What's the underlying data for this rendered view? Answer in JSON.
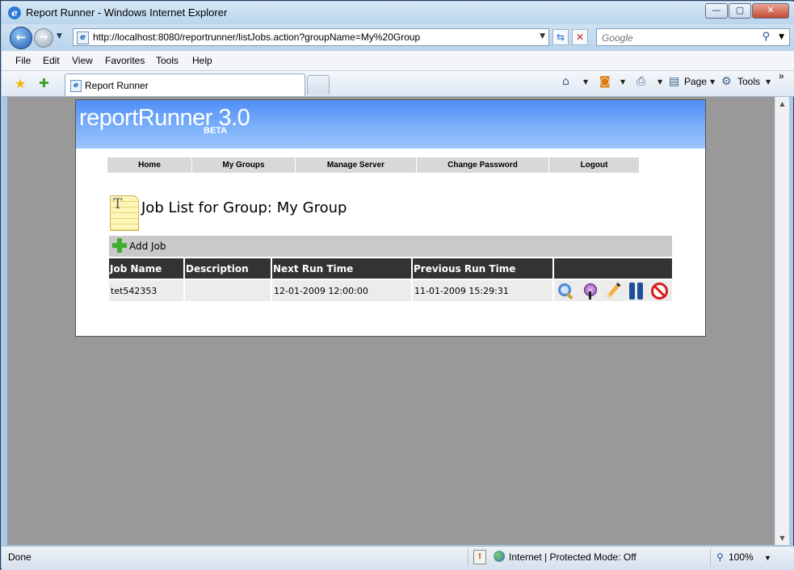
{
  "window": {
    "title": "Report Runner - Windows Internet Explorer",
    "minimize": "—",
    "maximize": "▢",
    "close": "✕"
  },
  "address": {
    "url": "http://localhost:8080/reportrunner/listJobs.action?groupName=My%20Group",
    "search_placeholder": "Google"
  },
  "menu": [
    "File",
    "Edit",
    "View",
    "Favorites",
    "Tools",
    "Help"
  ],
  "tab": {
    "label": "Report Runner"
  },
  "commandbar": {
    "page_label": "Page",
    "tools_label": "Tools",
    "chevrons": "»"
  },
  "app": {
    "logo": "reportRunner 3.0",
    "beta": "BETA",
    "nav": [
      "Home",
      "My Groups",
      "Manage Server",
      "Change Password",
      "Logout"
    ],
    "page_title": "Job List for Group: My Group",
    "add_job": "Add Job",
    "table": {
      "headers": [
        "Job Name",
        "Description",
        "Next Run Time",
        "Previous Run Time",
        ""
      ],
      "rows": [
        {
          "job_name": "tet542353",
          "description": "",
          "next_run": "12-01-2009 12:00:00",
          "previous_run": "11-01-2009 15:29:31",
          "actions": [
            "view-icon",
            "run-icon",
            "edit-icon",
            "pause-icon",
            "delete-icon"
          ]
        }
      ]
    }
  },
  "status": {
    "left": "Done",
    "zone": "Internet | Protected Mode: Off",
    "zoom": "100%"
  },
  "colors": {
    "header_gradient_top": "#4f8ff5",
    "header_gradient_bottom": "#9cc6fd",
    "table_header_bg": "#333333",
    "nav_bg": "#d8d8d8",
    "viewport_bg": "#999999"
  }
}
